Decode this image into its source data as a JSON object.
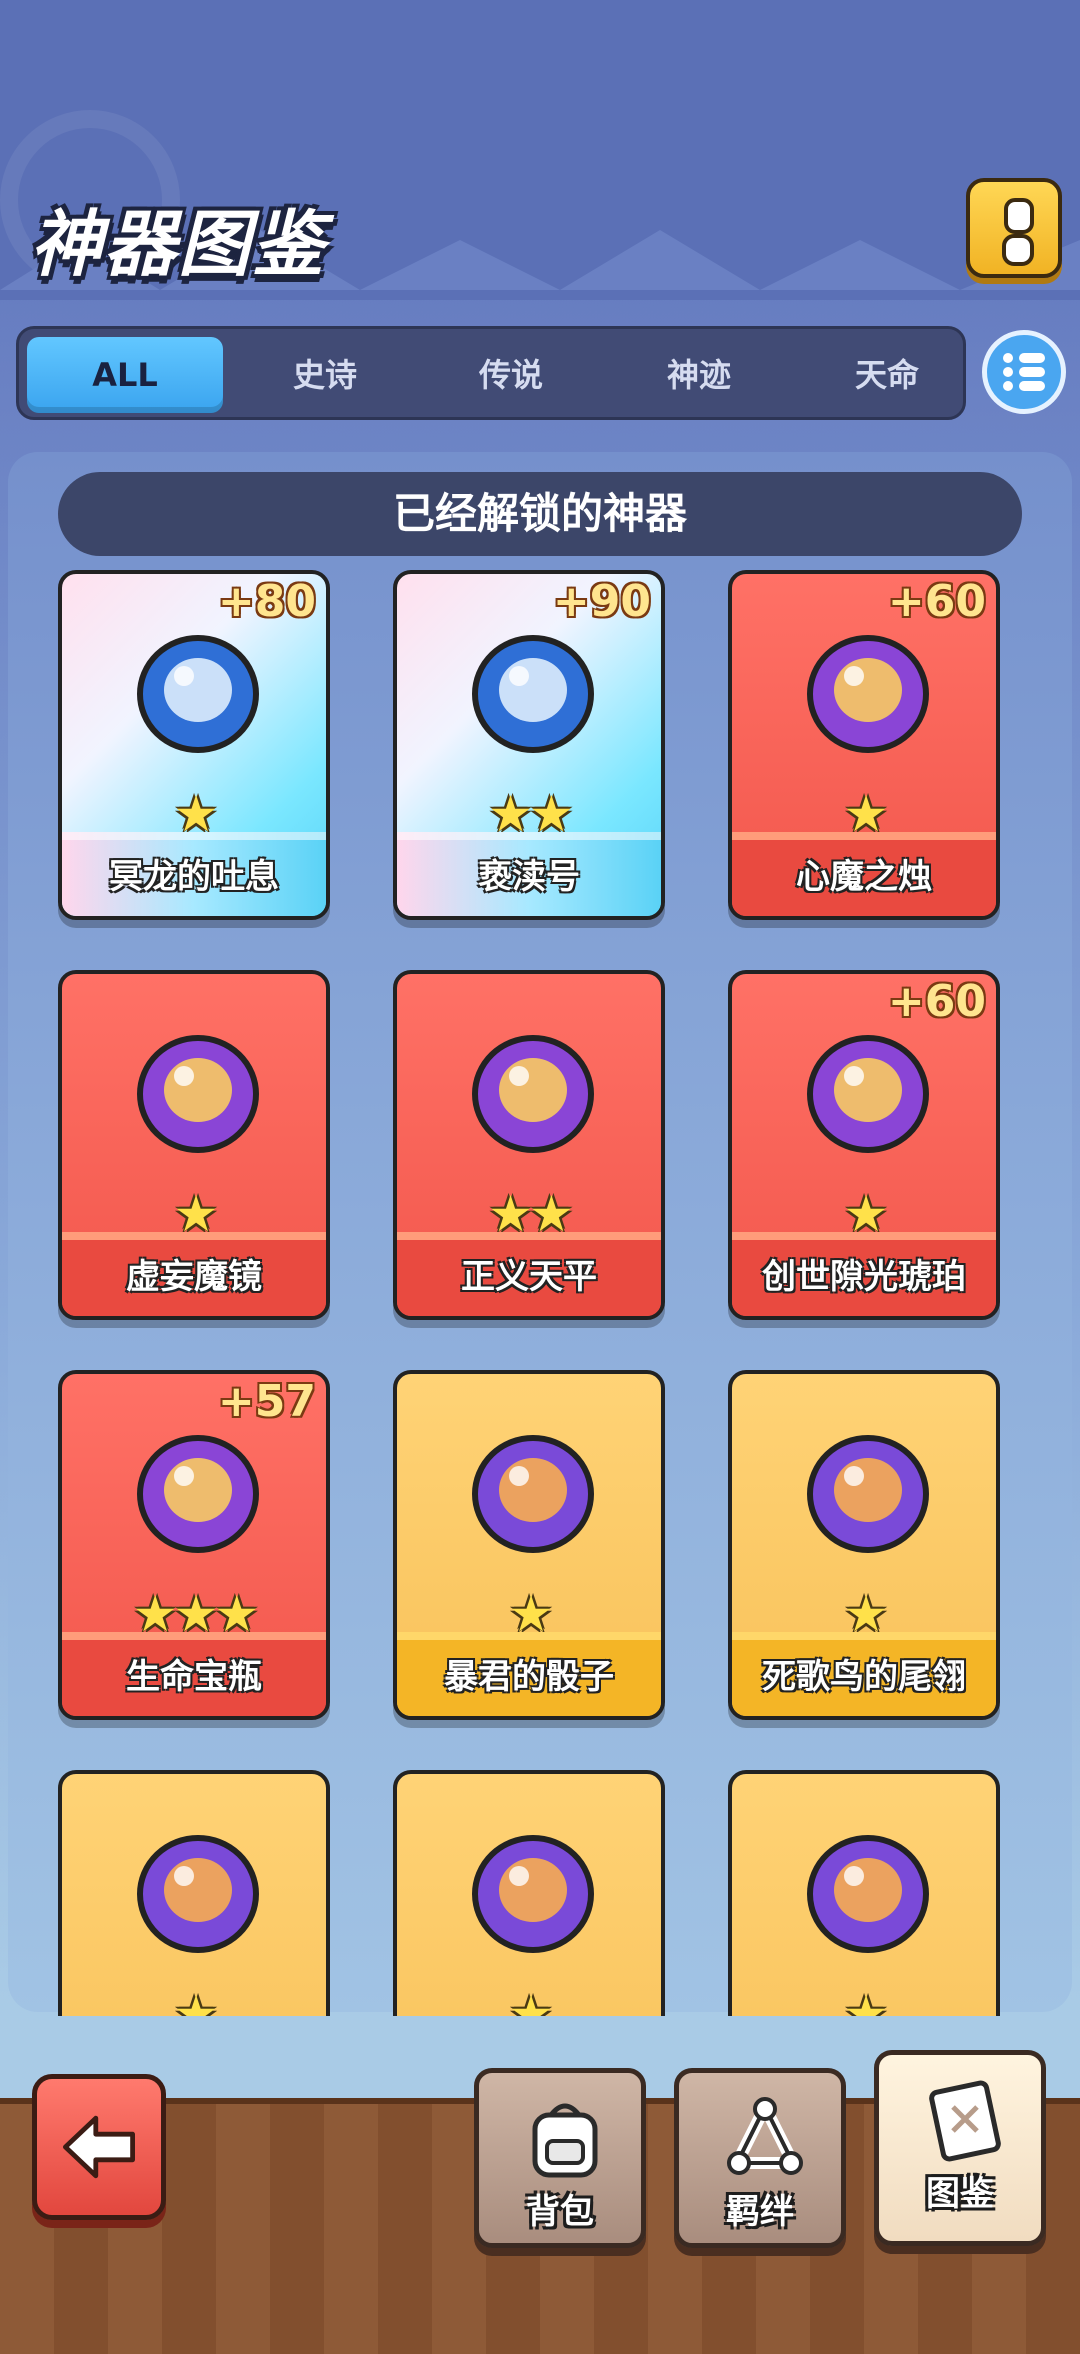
{
  "header": {
    "title": "神器图鉴"
  },
  "tabs": [
    {
      "label": "ALL",
      "active": true
    },
    {
      "label": "史诗"
    },
    {
      "label": "传说"
    },
    {
      "label": "神迹"
    },
    {
      "label": "天命"
    }
  ],
  "section_title": "已经解锁的神器",
  "artifacts": [
    {
      "name": "冥龙的吐息",
      "bonus": "+80",
      "stars": 1,
      "rarity": "epic"
    },
    {
      "name": "亵渎号",
      "bonus": "+90",
      "stars": 2,
      "rarity": "epic"
    },
    {
      "name": "心魔之烛",
      "bonus": "+60",
      "stars": 1,
      "rarity": "legend"
    },
    {
      "name": "虚妄魔镜",
      "bonus": "",
      "stars": 1,
      "rarity": "legend"
    },
    {
      "name": "正义天平",
      "bonus": "",
      "stars": 2,
      "rarity": "legend"
    },
    {
      "name": "创世隙光琥珀",
      "bonus": "+60",
      "stars": 1,
      "rarity": "legend"
    },
    {
      "name": "生命宝瓶",
      "bonus": "+57",
      "stars": 3,
      "rarity": "legend"
    },
    {
      "name": "暴君的骰子",
      "bonus": "",
      "stars": 1,
      "rarity": "miracle"
    },
    {
      "name": "死歌鸟的尾翎",
      "bonus": "",
      "stars": 1,
      "rarity": "miracle"
    },
    {
      "name": "",
      "bonus": "",
      "stars": 1,
      "rarity": "miracle"
    },
    {
      "name": "",
      "bonus": "",
      "stars": 1,
      "rarity": "miracle"
    },
    {
      "name": "",
      "bonus": "",
      "stars": 1,
      "rarity": "miracle"
    }
  ],
  "bottom_nav": [
    {
      "label": "背包",
      "icon": "backpack-icon"
    },
    {
      "label": "羁绊",
      "icon": "bond-icon"
    },
    {
      "label": "图鉴",
      "icon": "codex-book-icon",
      "selected": true
    }
  ],
  "colors": {
    "epic": "#56d2f7",
    "legend": "#f2574c",
    "miracle": "#f8c25a",
    "tab_active": "#3aa4ef"
  }
}
